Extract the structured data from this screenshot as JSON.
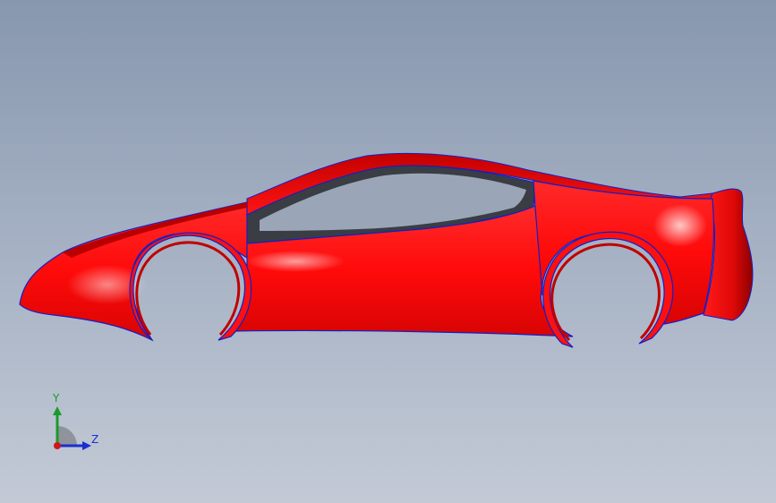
{
  "viewport": {
    "background_top": "#8797ae",
    "background_bottom": "#c3cad6"
  },
  "model": {
    "body_color": "#ff0a0a",
    "body_shadow_color": "#b80000",
    "glass_color": "#3a3d44",
    "edge_color": "#1020c8"
  },
  "triad": {
    "y_label": "Y",
    "z_label": "Z",
    "y_color": "#1a9a2a",
    "z_color": "#1a2fd0",
    "x_color": "#d01818"
  }
}
